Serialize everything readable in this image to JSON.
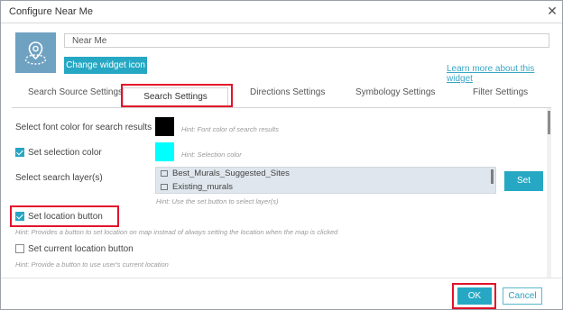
{
  "dialog": {
    "title": "Configure Near Me",
    "close_icon": "close-icon"
  },
  "widget": {
    "icon": "location-pin-icon",
    "name_value": "Near Me",
    "change_icon_label": "Change widget icon",
    "learn_more_label": "Learn more about this widget"
  },
  "tabs": [
    {
      "label": "Search Source Settings",
      "active": false
    },
    {
      "label": "Search Settings",
      "active": true
    },
    {
      "label": "Directions Settings",
      "active": false
    },
    {
      "label": "Symbology Settings",
      "active": false
    },
    {
      "label": "Filter Settings",
      "active": false
    }
  ],
  "settings": {
    "font_color": {
      "label": "Select font color for search results",
      "hint": "Hint: Font color of search results",
      "color": "#000000"
    },
    "selection_color": {
      "label": "Set selection color",
      "checked": true,
      "hint": "Hint: Selection color",
      "color": "#00ffff"
    },
    "search_layers": {
      "label": "Select search layer(s)",
      "layers": [
        "Best_Murals_Suggested_Sites",
        "Existing_murals"
      ],
      "hint": "Hint: Use the set button to select layer(s)",
      "set_label": "Set"
    },
    "location_button": {
      "label": "Set location button",
      "checked": true,
      "hint": "Hint: Provides a button to set location on map instead of always setting the location when the map is clicked"
    },
    "current_location_button": {
      "label": "Set current location button",
      "checked": false,
      "hint": "Hint: Provide a button to use user's current location"
    }
  },
  "footer": {
    "ok_label": "OK",
    "cancel_label": "Cancel"
  },
  "colors": {
    "accent": "#26a8c4",
    "highlight_red": "#e3122b",
    "icon_bg": "#6fa1c1"
  }
}
